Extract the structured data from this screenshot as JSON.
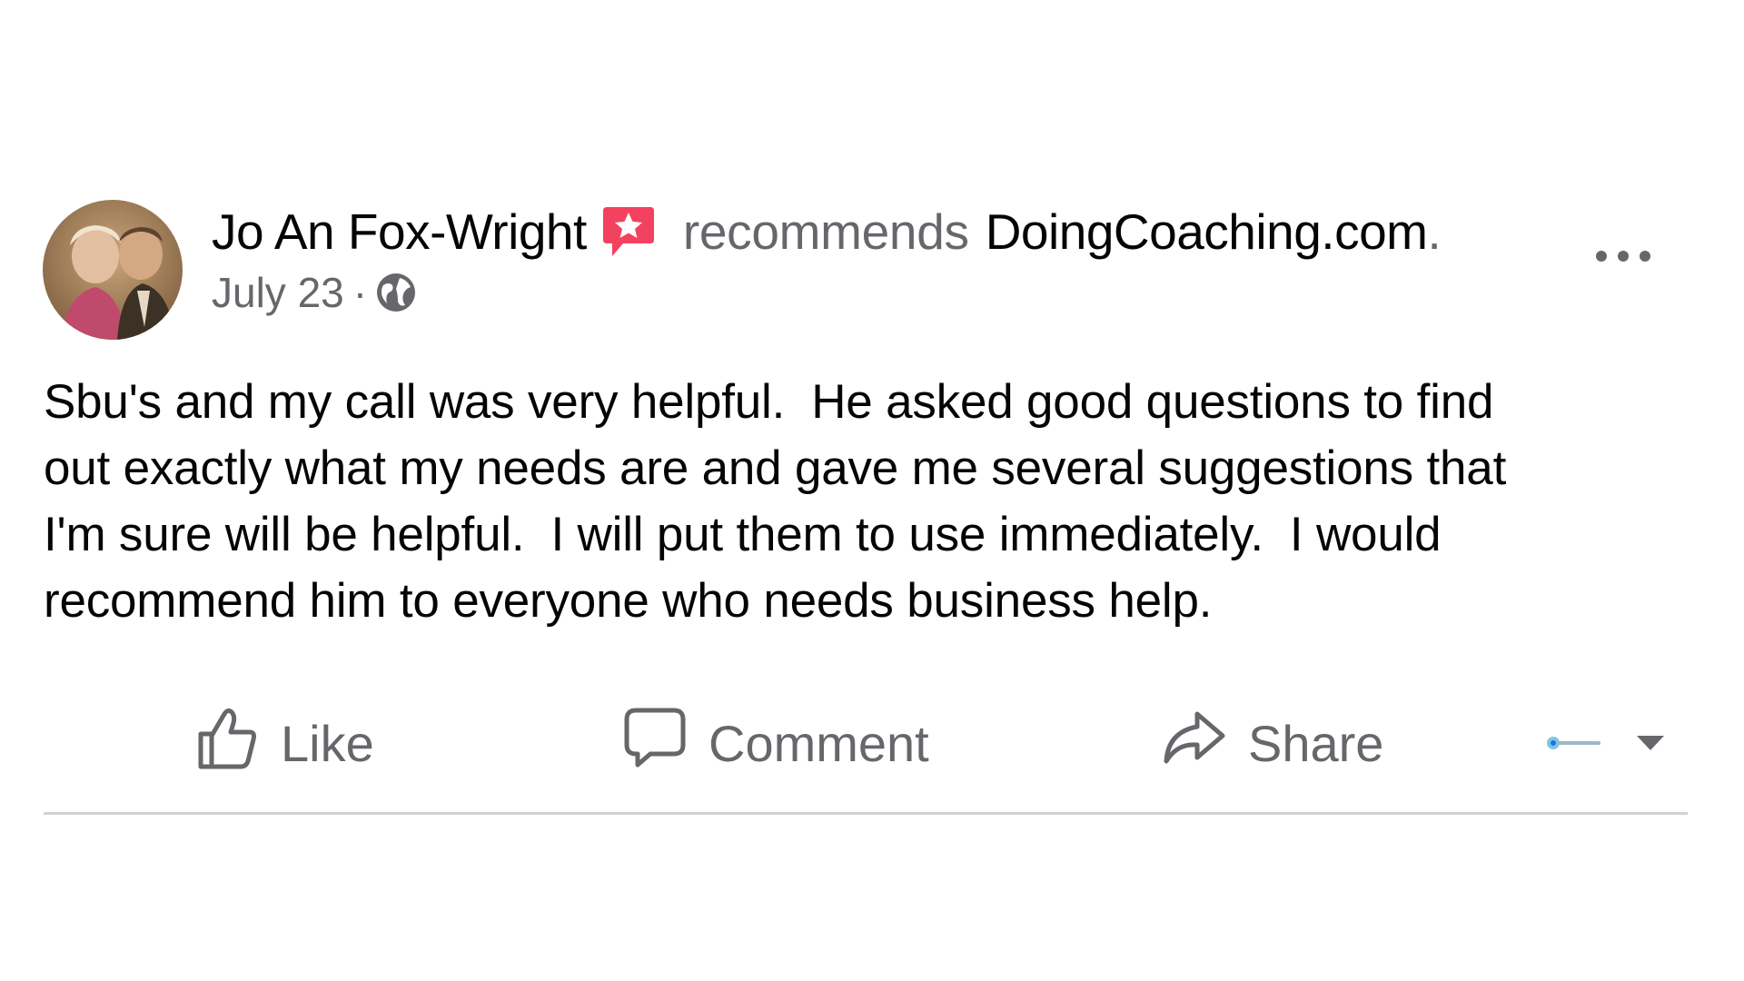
{
  "post": {
    "author": "Jo An Fox-Wright",
    "recommends_text": "recommends",
    "page_name": "DoingCoaching.com",
    "trailing_dot": ".",
    "date": "July 23",
    "separator": "·",
    "audience_icon": "globe-icon",
    "badge_icon": "recommendation-star-icon",
    "badge_color": "#f3425f",
    "more_icon": "more-options-icon",
    "text": "Sbu's and my call was very helpful.  He asked good questions to find\nout exactly what my needs are and gave me several suggestions that\nI'm sure will be helpful.  I will put them to use immediately.  I would\nrecommend him to everyone who needs business help."
  },
  "actions": {
    "like_label": "Like",
    "like_icon": "thumbs-up-icon",
    "comment_label": "Comment",
    "comment_icon": "comment-bubble-icon",
    "share_label": "Share",
    "share_icon": "share-arrow-icon",
    "reaction_selector_icon": "page-avatar-icon",
    "dropdown_icon": "caret-down-icon"
  },
  "colors": {
    "primary_text": "#050505",
    "secondary_text": "#65676b",
    "divider": "#d0d2d6"
  }
}
